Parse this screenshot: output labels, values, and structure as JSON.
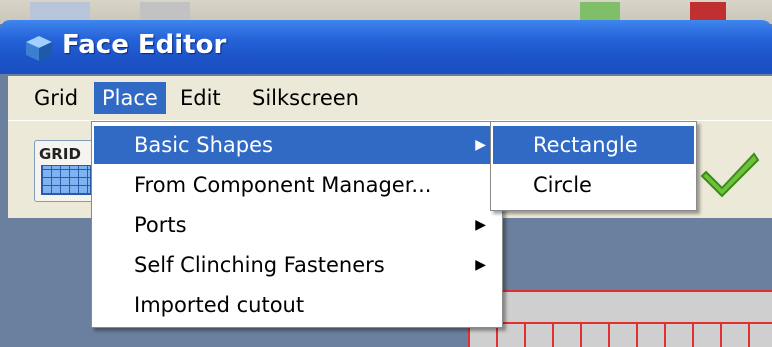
{
  "window": {
    "title": "Face Editor",
    "icon": "app-cube-icon"
  },
  "menubar": {
    "items": [
      {
        "label": "Grid"
      },
      {
        "label": "Place"
      },
      {
        "label": "Edit"
      },
      {
        "label": "Silkscreen"
      }
    ]
  },
  "toolbar": {
    "grid_button": {
      "label": "GRID",
      "icon": "grid-icon"
    },
    "check_button": {
      "icon": "checkmark-icon"
    }
  },
  "place_menu": {
    "items": [
      {
        "label": "Basic Shapes",
        "submenu": true
      },
      {
        "label": "From Component Manager...",
        "submenu": false
      },
      {
        "label": "Ports",
        "submenu": true
      },
      {
        "label": "Self Clinching Fasteners",
        "submenu": true
      },
      {
        "label": "Imported cutout",
        "submenu": false
      }
    ],
    "arrow_glyph": "▶"
  },
  "basic_shapes_submenu": {
    "items": [
      {
        "label": "Rectangle"
      },
      {
        "label": "Circle"
      }
    ]
  },
  "colors": {
    "menu_highlight": "#316ac5",
    "titlebar": "#2563d8",
    "canvas_line": "#e03030"
  }
}
